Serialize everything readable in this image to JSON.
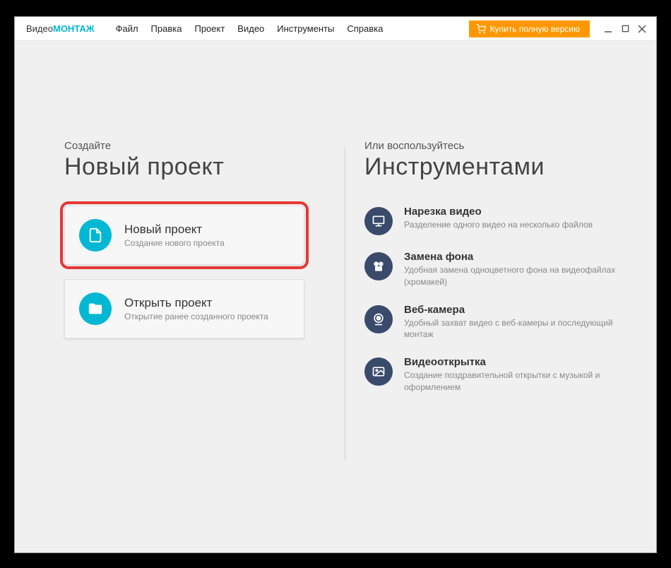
{
  "app": {
    "logo_prefix": "Видео",
    "logo_accent": "МОНТАЖ"
  },
  "menu": {
    "file": "Файл",
    "edit": "Правка",
    "project": "Проект",
    "video": "Видео",
    "tools": "Инструменты",
    "help": "Справка"
  },
  "buy_button": "Купить полную версию",
  "left": {
    "label": "Создайте",
    "title": "Новый проект",
    "new_project": {
      "title": "Новый проект",
      "sub": "Создание нового проекта"
    },
    "open_project": {
      "title": "Открыть проект",
      "sub": "Открытие ранее созданного проекта"
    }
  },
  "right": {
    "label": "Или воспользуйтесь",
    "title": "Инструментами",
    "cut": {
      "title": "Нарезка видео",
      "sub": "Разделение одного видео на несколько файлов"
    },
    "bg": {
      "title": "Замена фона",
      "sub": "Удобная замена одноцветного фона на видеофайлах (хромакей)"
    },
    "webcam": {
      "title": "Веб-камера",
      "sub": "Удобный захват видео с веб-камеры и последующий монтаж"
    },
    "postcard": {
      "title": "Видеооткрытка",
      "sub": "Создание поздравительной открытки с музыкой и оформлением"
    }
  }
}
